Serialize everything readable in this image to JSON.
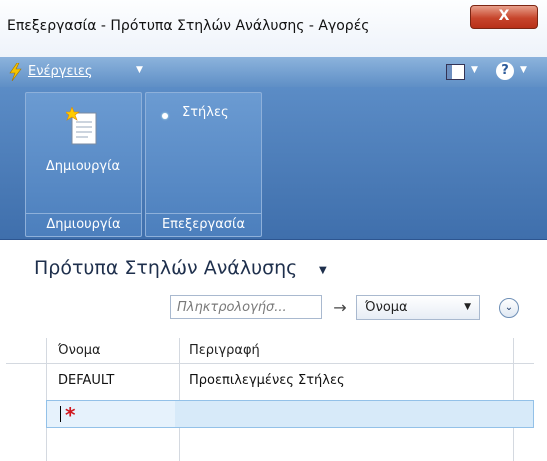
{
  "window": {
    "title": "Επεξεργασία - Πρότυπα Στηλών Ανάλυσης - Αγορές",
    "close_symbol": "X"
  },
  "actions_bar": {
    "actions_label": "Ενέργειες",
    "actions_icon": "lightning-icon",
    "layout_icon": "layout-icon",
    "help_symbol": "?",
    "chevron": "▼"
  },
  "ribbon": {
    "groups": [
      {
        "label": "Δημιουργία",
        "buttons": [
          {
            "label": "Δημιουργία",
            "icon": "new-document-icon"
          }
        ]
      },
      {
        "label": "Επεξεργασία",
        "buttons": [
          {
            "label": "Στήλες",
            "icon": "columns-icon"
          }
        ]
      }
    ]
  },
  "page": {
    "title": "Πρότυπα Στηλών Ανάλυσης",
    "title_chevron": "▼",
    "search": {
      "placeholder": "Πληκτρολογήσ..."
    },
    "go_symbol": "→",
    "filter_field": {
      "selected": "Όνομα"
    },
    "expand_symbol": "⌄"
  },
  "table": {
    "columns": [
      "Όνομα",
      "Περιγραφή"
    ],
    "rows": [
      {
        "name": "DEFAULT",
        "description": "Προεπιλεγμένες Στήλες"
      }
    ],
    "new_row_required_marker": "*"
  },
  "colors": {
    "ribbon": "#4c7fbd",
    "actions_bar": "#6f9ccf",
    "close_button": "#c7452c",
    "selected_row": "#d7eaf9",
    "required": "#d0161c"
  }
}
